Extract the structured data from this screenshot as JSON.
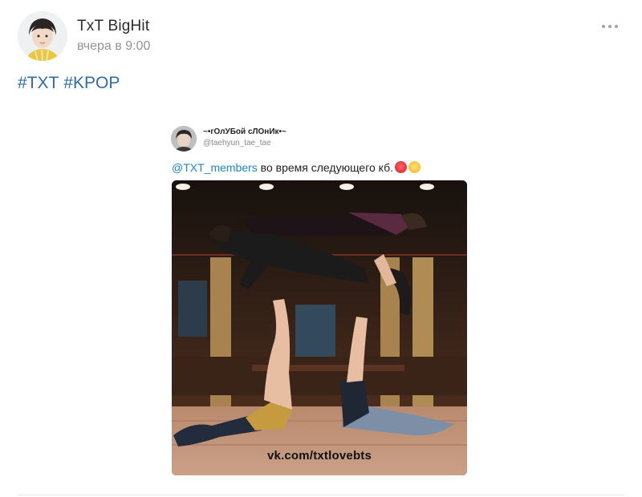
{
  "post": {
    "author": "TxT BigHit",
    "time": "вчера в 9:00",
    "hashtags": [
      "#TXT",
      "#KPOP"
    ],
    "more_icon": "ellipsis-icon"
  },
  "embedded_tweet": {
    "display_name": "~•гОлУБой сЛОнИк•~",
    "handle": "@taehyun_tae_tae",
    "mention": "@TXT_members",
    "text": " во время следующего кб.",
    "emojis": [
      "hot-face-emoji",
      "pleading-face-emoji"
    ],
    "watermark": "vk.com/txtlovebts"
  },
  "colors": {
    "link": "#2f6ba8",
    "mention": "#1d86c8",
    "meta": "#939393"
  }
}
